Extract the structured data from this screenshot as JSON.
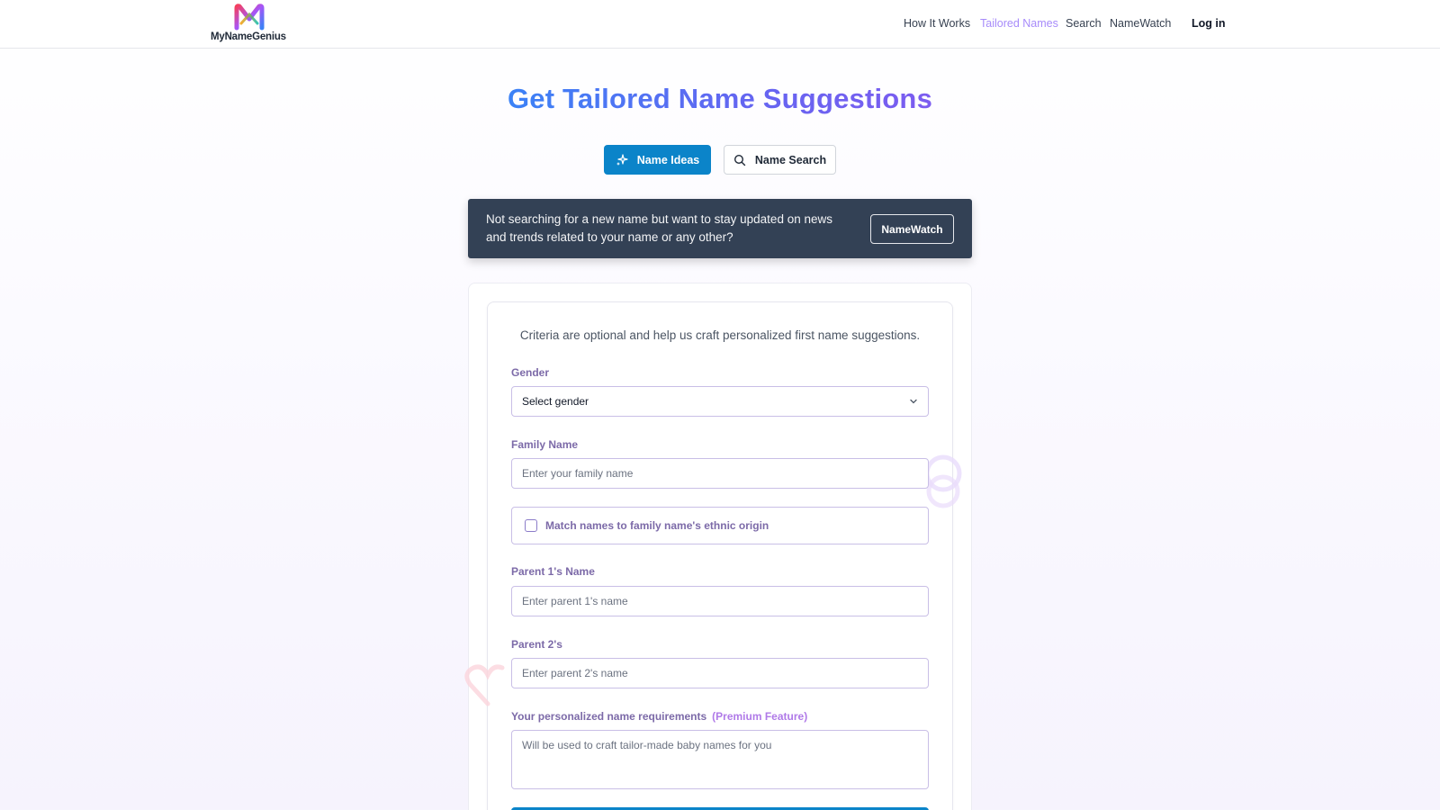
{
  "header": {
    "logo_text": "MyNameGenius",
    "nav": [
      "How It Works",
      "Tailored Names",
      "Search",
      "NameWatch"
    ],
    "active_nav": "Tailored Names",
    "login_label": "Log in"
  },
  "page": {
    "title": "Get Tailored Name Suggestions"
  },
  "modes": {
    "ideas_label": "Name Ideas",
    "search_label": "Name Search"
  },
  "banner": {
    "text": "Not searching for a new name but want to stay updated on news and trends related to your name or any other?",
    "button_label": "NameWatch"
  },
  "form": {
    "intro": "Criteria are optional and help us craft personalized first name suggestions.",
    "gender_label": "Gender",
    "gender_value": "Select gender",
    "family_label": "Family Name",
    "family_placeholder": "Enter your family name",
    "match_origin_label": "Match names to family name's ethnic origin",
    "parent1_label": "Parent 1's Name",
    "parent1_placeholder": "Enter parent 1's name",
    "parent2_label": "Parent 2's",
    "parent2_placeholder": "Enter parent 2's name",
    "requirements_label": "Your personalized name requirements",
    "requirements_badge": "(Premium Feature)",
    "requirements_placeholder": "Will be used to craft tailor-made baby names for you"
  },
  "colors": {
    "accent": "#0b84c9",
    "title_gradient_start": "#3b82f6",
    "title_gradient_end": "#7c5cf0",
    "nav_active": "#a78bfa",
    "banner_bg": "#334155",
    "label": "#7c6aa8"
  },
  "icons": {
    "logo": "m-logo-icon",
    "ideas": "sparkles-icon",
    "search": "search-icon",
    "select": "chevron-down-icon"
  }
}
